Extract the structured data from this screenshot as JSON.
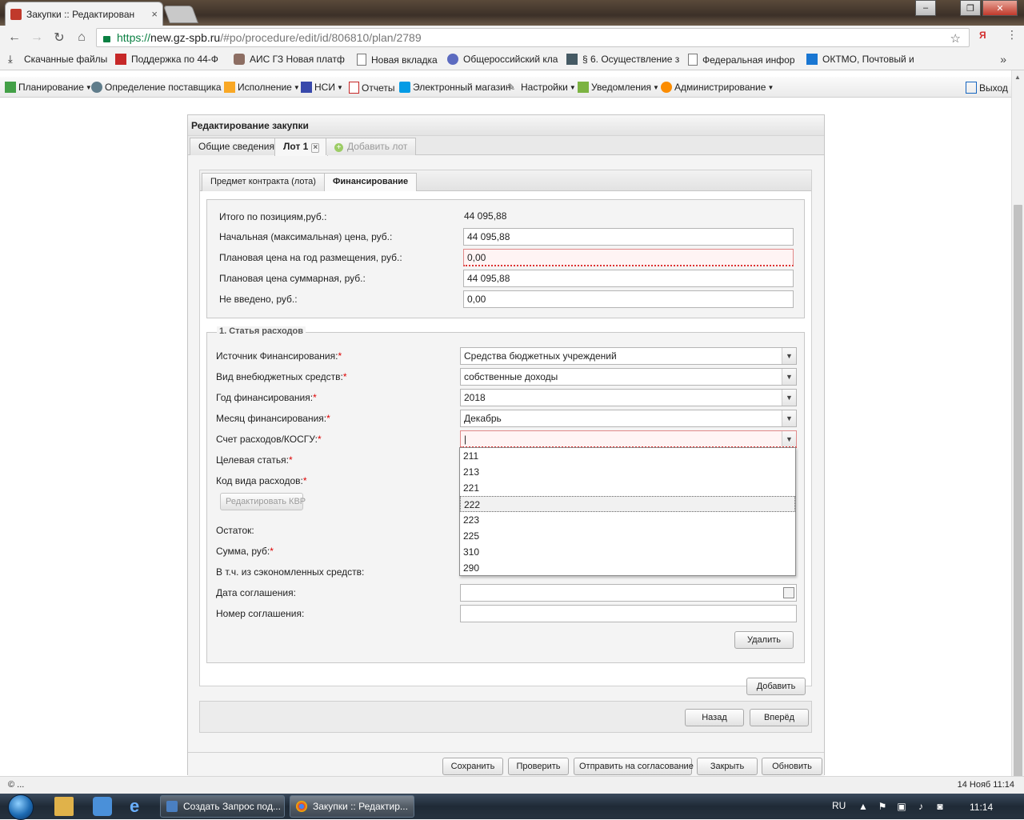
{
  "browser": {
    "tab_title": "Закупки :: Редактирован",
    "tab_close": "×",
    "url_scheme": "https://",
    "url_host": "new.gz-spb.ru",
    "url_path": "/#po/procedure/edit/id/806810/plan/2789",
    "ya_label": "Я",
    "bookmarks": [
      {
        "label": "Скачанные файлы",
        "icon": "download-icon"
      },
      {
        "label": "Поддержка по 44-Ф",
        "icon": "iz-logo-icon"
      },
      {
        "label": "АИС ГЗ Новая платф",
        "icon": "tools-icon"
      },
      {
        "label": "Новая вкладка",
        "icon": "page-icon"
      },
      {
        "label": "Общероссийский кла",
        "icon": "emblem-icon"
      },
      {
        "label": "§ 6. Осуществление з",
        "icon": "portrait-icon"
      },
      {
        "label": "Федеральная инфор",
        "icon": "page-icon"
      },
      {
        "label": "ОКТМО, Почтовый и",
        "icon": "kod-icon"
      }
    ],
    "bookmarks_more": "»"
  },
  "app_menu": {
    "items": [
      {
        "label": "Планирование",
        "icon": "planning-icon"
      },
      {
        "label": "Определение поставщика",
        "icon": "supplier-icon"
      },
      {
        "label": "Исполнение",
        "icon": "execution-icon"
      },
      {
        "label": "НСИ",
        "icon": "book-icon"
      },
      {
        "label": "Отчеты",
        "icon": "report-icon"
      },
      {
        "label": "Электронный магазин",
        "icon": "cart-icon"
      },
      {
        "label": "Настройки",
        "icon": "wrench-icon"
      },
      {
        "label": "Уведомления",
        "icon": "notification-icon"
      },
      {
        "label": "Администрирование",
        "icon": "admin-icon"
      }
    ],
    "exit_label": "Выход"
  },
  "panel": {
    "title": "Редактирование закупки",
    "tabs": [
      {
        "label": "Общие сведения"
      },
      {
        "label": "Лот 1",
        "active": true
      },
      {
        "label": "Добавить лот",
        "disabled": true
      }
    ],
    "subtabs": [
      {
        "label": "Предмет контракта (лота)"
      },
      {
        "label": "Финансирование",
        "active": true
      }
    ]
  },
  "totals": {
    "items_total_label": "Итого по позициям,руб.:",
    "items_total_value": "44 095,88",
    "nmc_label": "Начальная (максимальная) цена, руб.:",
    "nmc_value": "44 095,88",
    "plan_year_label": "Плановая цена на год размещения, руб.:",
    "plan_year_value": "0,00",
    "plan_sum_label": "Плановая цена суммарная, руб.:",
    "plan_sum_value": "44 095,88",
    "not_entered_label": "Не введено, руб.:",
    "not_entered_value": "0,00"
  },
  "expense": {
    "legend": "1. Статья расходов",
    "source_label": "Источник Финансирования:",
    "source_value": "Средства бюджетных учреждений",
    "offbudget_label": "Вид внебюджетных средств:",
    "offbudget_value": "собственные доходы",
    "year_label": "Год финансирования:",
    "year_value": "2018",
    "month_label": "Месяц финансирования:",
    "month_value": "Декабрь",
    "kosgu_label": "Счет расходов/КОСГУ:",
    "kosgu_value": "|",
    "target_label": "Целевая статья:",
    "kvr_label": "Код вида расходов:",
    "edit_kvr_button": "Редактировать КВР",
    "remainder_label": "Остаток:",
    "sum_label": "Сумма, руб:",
    "saved_label": "В т.ч. из сэкономленных средств:",
    "agreement_date_label": "Дата соглашения:",
    "agreement_number_label": "Номер соглашения:",
    "delete_button": "Удалить",
    "required_mark": "*"
  },
  "kosgu_options": [
    "211",
    "213",
    "221",
    "222",
    "223",
    "225",
    "310",
    "290"
  ],
  "kosgu_highlighted": "222",
  "buttons": {
    "add": "Добавить",
    "back": "Назад",
    "forward": "Вперёд",
    "save": "Сохранить",
    "check": "Проверить",
    "send": "Отправить на согласование",
    "close": "Закрыть",
    "refresh": "Обновить"
  },
  "status": {
    "left": "© ...",
    "right": "14 Нояб 11:14"
  },
  "taskbar": {
    "tasks": [
      {
        "label": "Создать Запрос под..."
      },
      {
        "label": "Закупки :: Редактир..."
      }
    ],
    "lang": "RU",
    "time": "11:14"
  },
  "colors": {
    "required": "#dd0000",
    "invalid_border": "#e08a8a",
    "https_green": "#0b8043"
  }
}
